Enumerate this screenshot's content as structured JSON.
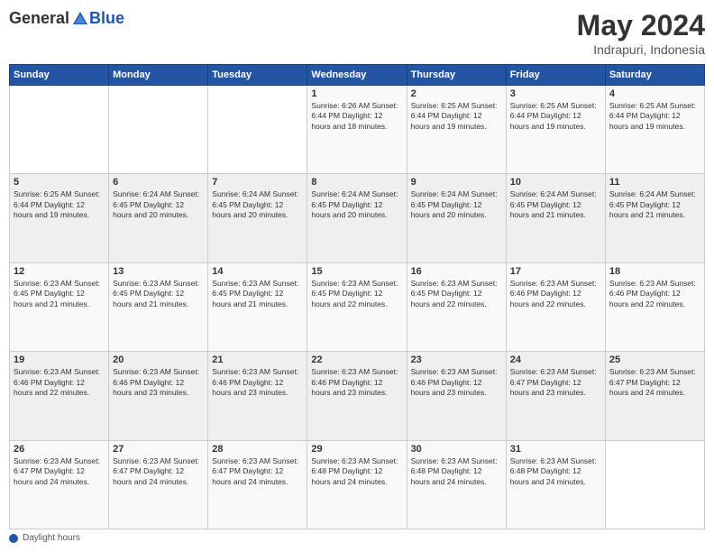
{
  "header": {
    "logo_general": "General",
    "logo_blue": "Blue",
    "title": "May 2024",
    "subtitle": "Indrapuri, Indonesia"
  },
  "weekdays": [
    "Sunday",
    "Monday",
    "Tuesday",
    "Wednesday",
    "Thursday",
    "Friday",
    "Saturday"
  ],
  "footer": {
    "label": "Daylight hours"
  },
  "weeks": [
    [
      {
        "day": "",
        "info": ""
      },
      {
        "day": "",
        "info": ""
      },
      {
        "day": "",
        "info": ""
      },
      {
        "day": "1",
        "info": "Sunrise: 6:26 AM\nSunset: 6:44 PM\nDaylight: 12 hours\nand 18 minutes."
      },
      {
        "day": "2",
        "info": "Sunrise: 6:25 AM\nSunset: 6:44 PM\nDaylight: 12 hours\nand 19 minutes."
      },
      {
        "day": "3",
        "info": "Sunrise: 6:25 AM\nSunset: 6:44 PM\nDaylight: 12 hours\nand 19 minutes."
      },
      {
        "day": "4",
        "info": "Sunrise: 6:25 AM\nSunset: 6:44 PM\nDaylight: 12 hours\nand 19 minutes."
      }
    ],
    [
      {
        "day": "5",
        "info": "Sunrise: 6:25 AM\nSunset: 6:44 PM\nDaylight: 12 hours\nand 19 minutes."
      },
      {
        "day": "6",
        "info": "Sunrise: 6:24 AM\nSunset: 6:45 PM\nDaylight: 12 hours\nand 20 minutes."
      },
      {
        "day": "7",
        "info": "Sunrise: 6:24 AM\nSunset: 6:45 PM\nDaylight: 12 hours\nand 20 minutes."
      },
      {
        "day": "8",
        "info": "Sunrise: 6:24 AM\nSunset: 6:45 PM\nDaylight: 12 hours\nand 20 minutes."
      },
      {
        "day": "9",
        "info": "Sunrise: 6:24 AM\nSunset: 6:45 PM\nDaylight: 12 hours\nand 20 minutes."
      },
      {
        "day": "10",
        "info": "Sunrise: 6:24 AM\nSunset: 6:45 PM\nDaylight: 12 hours\nand 21 minutes."
      },
      {
        "day": "11",
        "info": "Sunrise: 6:24 AM\nSunset: 6:45 PM\nDaylight: 12 hours\nand 21 minutes."
      }
    ],
    [
      {
        "day": "12",
        "info": "Sunrise: 6:23 AM\nSunset: 6:45 PM\nDaylight: 12 hours\nand 21 minutes."
      },
      {
        "day": "13",
        "info": "Sunrise: 6:23 AM\nSunset: 6:45 PM\nDaylight: 12 hours\nand 21 minutes."
      },
      {
        "day": "14",
        "info": "Sunrise: 6:23 AM\nSunset: 6:45 PM\nDaylight: 12 hours\nand 21 minutes."
      },
      {
        "day": "15",
        "info": "Sunrise: 6:23 AM\nSunset: 6:45 PM\nDaylight: 12 hours\nand 22 minutes."
      },
      {
        "day": "16",
        "info": "Sunrise: 6:23 AM\nSunset: 6:45 PM\nDaylight: 12 hours\nand 22 minutes."
      },
      {
        "day": "17",
        "info": "Sunrise: 6:23 AM\nSunset: 6:46 PM\nDaylight: 12 hours\nand 22 minutes."
      },
      {
        "day": "18",
        "info": "Sunrise: 6:23 AM\nSunset: 6:46 PM\nDaylight: 12 hours\nand 22 minutes."
      }
    ],
    [
      {
        "day": "19",
        "info": "Sunrise: 6:23 AM\nSunset: 6:46 PM\nDaylight: 12 hours\nand 22 minutes."
      },
      {
        "day": "20",
        "info": "Sunrise: 6:23 AM\nSunset: 6:46 PM\nDaylight: 12 hours\nand 23 minutes."
      },
      {
        "day": "21",
        "info": "Sunrise: 6:23 AM\nSunset: 6:46 PM\nDaylight: 12 hours\nand 23 minutes."
      },
      {
        "day": "22",
        "info": "Sunrise: 6:23 AM\nSunset: 6:46 PM\nDaylight: 12 hours\nand 23 minutes."
      },
      {
        "day": "23",
        "info": "Sunrise: 6:23 AM\nSunset: 6:46 PM\nDaylight: 12 hours\nand 23 minutes."
      },
      {
        "day": "24",
        "info": "Sunrise: 6:23 AM\nSunset: 6:47 PM\nDaylight: 12 hours\nand 23 minutes."
      },
      {
        "day": "25",
        "info": "Sunrise: 6:23 AM\nSunset: 6:47 PM\nDaylight: 12 hours\nand 24 minutes."
      }
    ],
    [
      {
        "day": "26",
        "info": "Sunrise: 6:23 AM\nSunset: 6:47 PM\nDaylight: 12 hours\nand 24 minutes."
      },
      {
        "day": "27",
        "info": "Sunrise: 6:23 AM\nSunset: 6:47 PM\nDaylight: 12 hours\nand 24 minutes."
      },
      {
        "day": "28",
        "info": "Sunrise: 6:23 AM\nSunset: 6:47 PM\nDaylight: 12 hours\nand 24 minutes."
      },
      {
        "day": "29",
        "info": "Sunrise: 6:23 AM\nSunset: 6:48 PM\nDaylight: 12 hours\nand 24 minutes."
      },
      {
        "day": "30",
        "info": "Sunrise: 6:23 AM\nSunset: 6:48 PM\nDaylight: 12 hours\nand 24 minutes."
      },
      {
        "day": "31",
        "info": "Sunrise: 6:23 AM\nSunset: 6:48 PM\nDaylight: 12 hours\nand 24 minutes."
      },
      {
        "day": "",
        "info": ""
      }
    ]
  ]
}
